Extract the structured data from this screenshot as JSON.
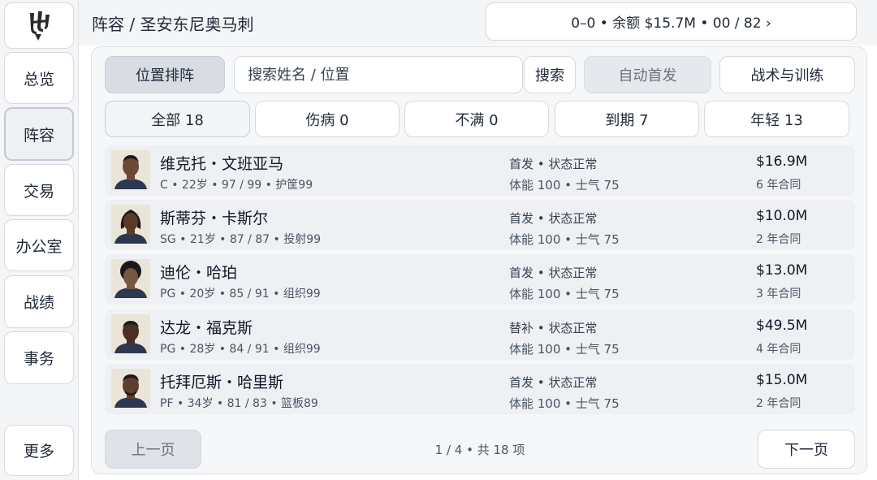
{
  "sidebar": {
    "items": [
      {
        "label": "总览"
      },
      {
        "label": "阵容",
        "active": true
      },
      {
        "label": "交易"
      },
      {
        "label": "办公室"
      },
      {
        "label": "战绩"
      },
      {
        "label": "事务"
      },
      {
        "label": "更多"
      }
    ]
  },
  "header": {
    "title": "阵容 / 圣安东尼奥马刺",
    "record": "0–0 • 余额 $15.7M • 00 / 82 ›"
  },
  "toolbar": {
    "position_sort": "位置排阵",
    "search_placeholder": "搜索姓名 / 位置",
    "search_button": "搜索",
    "auto_start": "自动首发",
    "tactics": "战术与训练"
  },
  "filters": [
    {
      "label": "全部 18"
    },
    {
      "label": "伤病 0"
    },
    {
      "label": "不满 0"
    },
    {
      "label": "到期 7"
    },
    {
      "label": "年轻 13"
    }
  ],
  "players": [
    {
      "name": "维克托・文班亚马",
      "meta": "C • 22岁 • 97 / 99 • 护筐99",
      "status": "首发 • 状态正常",
      "cond": "体能 100 • 士气 75",
      "salary": "$16.9M",
      "contract": "6 年合同"
    },
    {
      "name": "斯蒂芬・卡斯尔",
      "meta": "SG • 21岁 • 87 / 87 • 投射99",
      "status": "首发 • 状态正常",
      "cond": "体能 100 • 士气 75",
      "salary": "$10.0M",
      "contract": "2 年合同"
    },
    {
      "name": "迪伦・哈珀",
      "meta": "PG • 20岁 • 85 / 91 • 组织99",
      "status": "首发 • 状态正常",
      "cond": "体能 100 • 士气 75",
      "salary": "$13.0M",
      "contract": "3 年合同"
    },
    {
      "name": "达龙・福克斯",
      "meta": "PG • 28岁 • 84 / 91 • 组织99",
      "status": "替补 • 状态正常",
      "cond": "体能 100 • 士气 75",
      "salary": "$49.5M",
      "contract": "4 年合同"
    },
    {
      "name": "托拜厄斯・哈里斯",
      "meta": "PF • 34岁 • 81 / 83 • 篮板89",
      "status": "首发 • 状态正常",
      "cond": "体能 100 • 士气 75",
      "salary": "$15.0M",
      "contract": "2 年合同"
    }
  ],
  "pager": {
    "prev": "上一页",
    "info": "1 / 4 • 共 18 项",
    "next": "下一页"
  },
  "colors": {
    "panel_bg": "#f6f7f9",
    "row_bg": "#eef0f3",
    "active_btn": "#d9dde3",
    "jersey": "#2b3850"
  }
}
